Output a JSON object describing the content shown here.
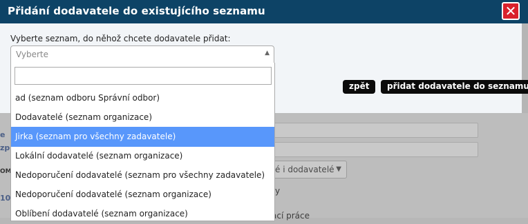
{
  "modal": {
    "title": "Přidání dodavatele do existujícího seznamu",
    "close_symbol": "✕",
    "label": "Vyberte seznam, do něhož chcete dodavatele přidat:",
    "select_placeholder": "Vyberte",
    "select_arrow": "▲",
    "search_value": "",
    "back_label": "zpět",
    "add_label": "přidat dodavatele do seznamu",
    "options": [
      "ad (seznam odboru Správní odbor)",
      "Dodavatelé (seznam organizace)",
      "Jirka (seznam pro všechny zadavatele)",
      "Lokální dodavatelé (seznam organizace)",
      "Nedoporučení dodavatelé (seznam pro všechny zadavatele)",
      "Nedoporučení dodavatelé (seznam organizace)",
      "Oblíbení dodavatelé (seznam organizace)"
    ],
    "highlighted_index": 2
  },
  "background": {
    "select_value": "é i dodavatelé",
    "select_arrow": "▼",
    "text_y": "y",
    "text_prace": "ací práce",
    "left_fragments": [
      "e",
      "zpr",
      "OM",
      "10"
    ]
  },
  "colors": {
    "header_bg": "#0d4366",
    "close_bg": "#d9212c",
    "highlight": "#5897fb",
    "button_bg": "#0b0b0b"
  },
  "icons": {
    "close": "close-icon",
    "select_arrow": "chevron-up-icon",
    "bg_select_arrow": "chevron-down-icon"
  }
}
